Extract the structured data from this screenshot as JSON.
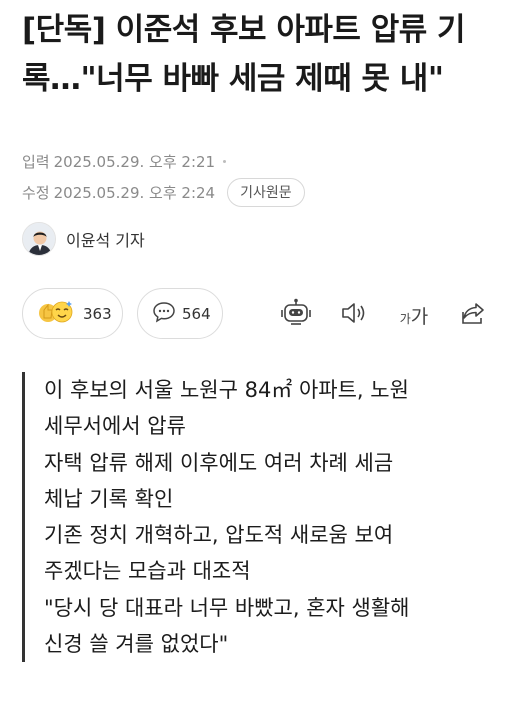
{
  "article": {
    "headline": "[단독] 이준석 후보 아파트 압류 기록…\"너무 바빠 세금 제때 못 내\"",
    "input_label": "입력",
    "input_time": "2025.05.29. 오후 2:21",
    "modified_label": "수정",
    "modified_time": "2025.05.29. 오후 2:24",
    "source_button": "기사원문",
    "reporter": "이윤석 기자"
  },
  "actions": {
    "reaction_count": "363",
    "comment_count": "564",
    "fontsize_small": "가",
    "fontsize_big": "가"
  },
  "icons": [
    "reaction-emoji-icon",
    "comment-icon",
    "robot-summary-icon",
    "speaker-icon",
    "font-size-icon",
    "share-icon"
  ],
  "summary": {
    "lines": [
      "이 후보의 서울 노원구 84㎡ 아파트, 노원",
      "세무서에서 압류",
      "자택 압류 해제 이후에도 여러 차례 세금",
      "체납 기록 확인",
      "기존 정치 개혁하고, 압도적 새로움 보여",
      "주겠다는 모습과 대조적",
      "\"당시 당 대표라 너무 바빴고, 혼자 생활해",
      "신경 쓸 겨를 없었다\""
    ]
  },
  "colors": {
    "text": "#1a1a1a",
    "meta": "#8a8a8a",
    "border": "#dcdcdc",
    "quote_bar": "#333333"
  }
}
